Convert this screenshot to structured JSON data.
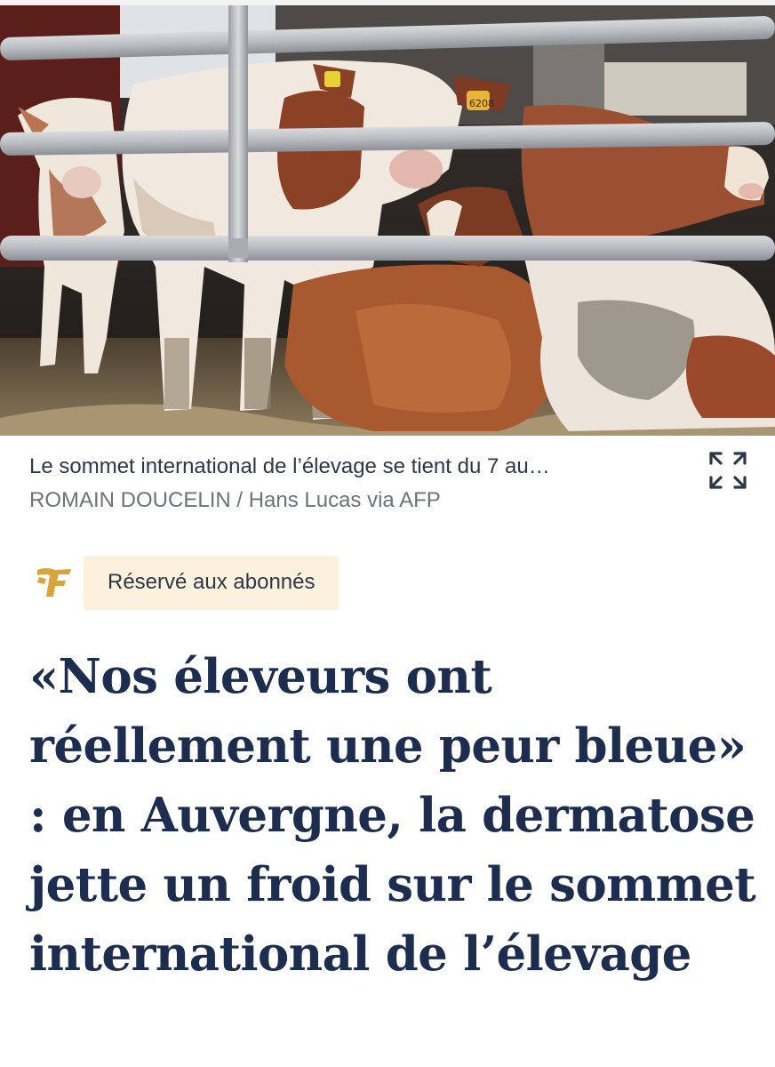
{
  "photo": {
    "alt": "Vaches derrière une barrière",
    "ear_tag": "6208"
  },
  "caption": {
    "text": "Le sommet international de l’élevage se tient du 7 au…",
    "credit": "ROMAIN DOUCELIN / Hans Lucas via AFP"
  },
  "icons": {
    "expand": "expand-icon",
    "logo": "le-figaro-f-logo"
  },
  "badge": {
    "label": "Réservé aux abonnés"
  },
  "article": {
    "headline": "«Nos éleveurs ont réellement une peur bleue» : en Auvergne, la dermatose jette un froid sur le sommet international de l’élevage"
  },
  "colors": {
    "headline": "#1d2d4f",
    "badge_bg": "#fcf1dd",
    "logo_gold": "#d9a43a",
    "credit": "#6e727a"
  }
}
